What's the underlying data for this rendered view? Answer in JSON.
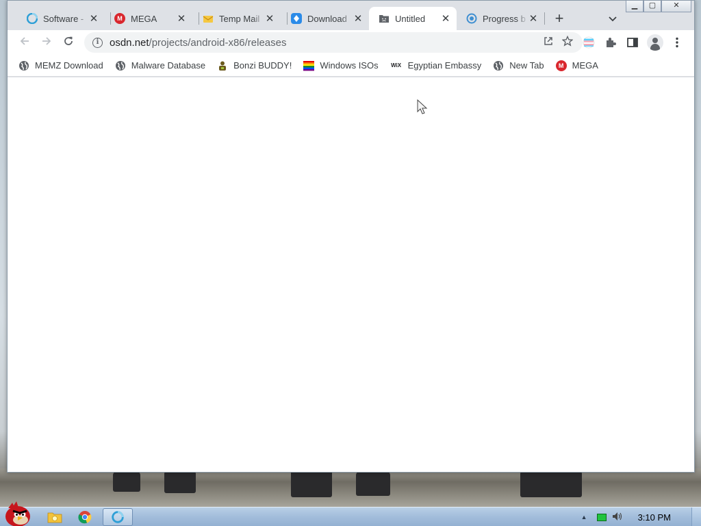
{
  "browser": {
    "tabs": [
      {
        "title": "Software - ",
        "favicon": "globe-blue-icon",
        "active": false
      },
      {
        "title": "MEGA",
        "favicon": "mega-icon",
        "active": false
      },
      {
        "title": "Temp Mail",
        "favicon": "mail-icon",
        "active": false
      },
      {
        "title": "Download",
        "favicon": "download-icon",
        "active": false
      },
      {
        "title": "Untitled",
        "favicon": "sad-folder-icon",
        "active": true
      },
      {
        "title": "Progress b",
        "favicon": "progress-icon",
        "active": false
      }
    ],
    "new_tab": "+",
    "tab_search": "⌄",
    "toolbar": {
      "url_domain": "osdn.net",
      "url_path": "/projects/android-x86/releases"
    },
    "bookmarks": [
      {
        "label": "MEMZ Download",
        "icon": "globe-icon"
      },
      {
        "label": "Malware Database",
        "icon": "globe-icon"
      },
      {
        "label": "Bonzi BUDDY!",
        "icon": "bonzi-icon"
      },
      {
        "label": "Windows ISOs",
        "icon": "rainbow-flag-icon"
      },
      {
        "label": "Egyptian Embassy",
        "icon": "wix-icon"
      },
      {
        "label": "New Tab",
        "icon": "globe-icon"
      },
      {
        "label": "MEGA",
        "icon": "mega-icon"
      }
    ],
    "wix_glyph": "WiX",
    "mega_glyph": "M"
  },
  "taskbar": {
    "clock": "3:10 PM",
    "tray_arrow": "▲"
  },
  "colors": {
    "mega_red": "#d9272e",
    "chrome_frame": "#dee1e6",
    "taskbar_blue": "#a2bddb"
  }
}
